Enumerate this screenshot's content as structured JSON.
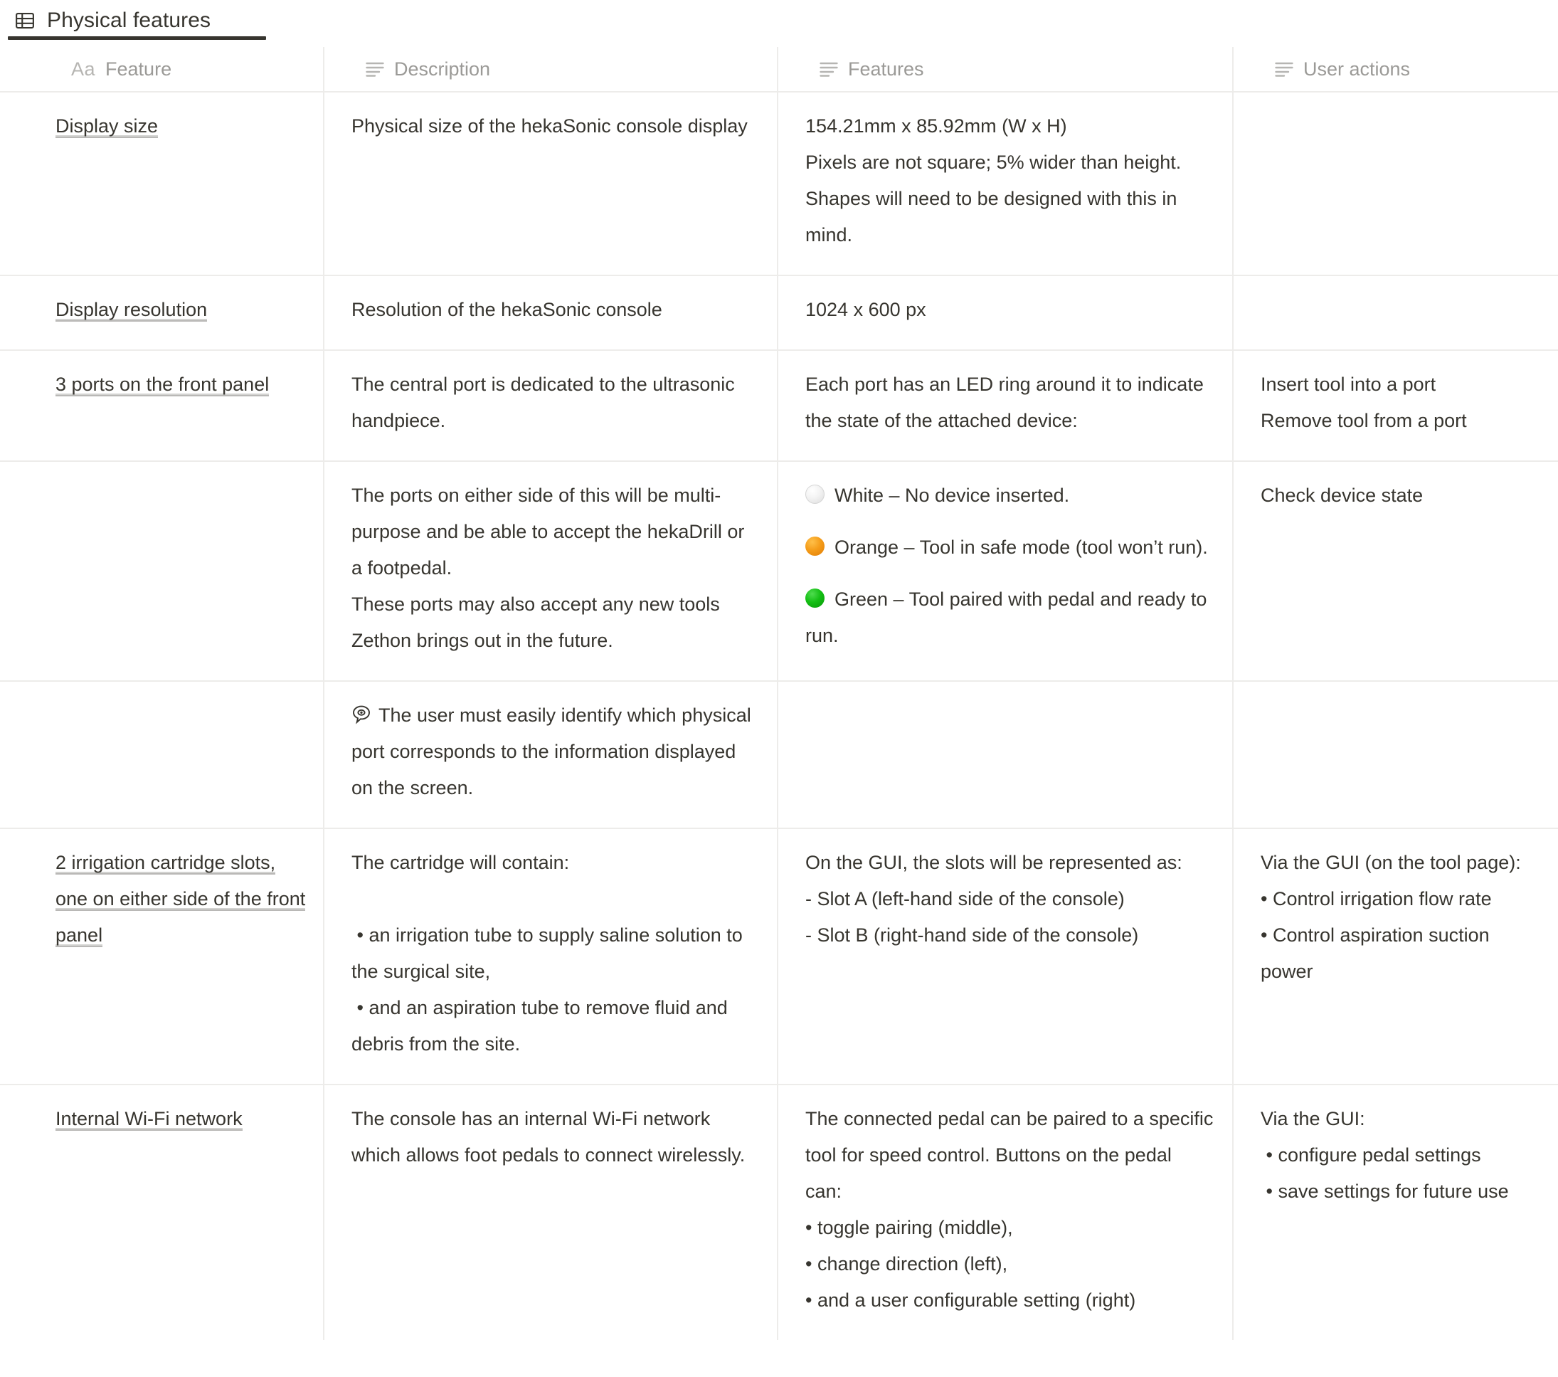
{
  "view": {
    "tab_label": "Physical features",
    "tab_icon": "table-icon",
    "active": true
  },
  "table": {
    "columns": [
      {
        "label": "Feature",
        "icon": "title-text-icon"
      },
      {
        "label": "Description",
        "icon": "text-lines-icon"
      },
      {
        "label": "Features",
        "icon": "text-lines-icon"
      },
      {
        "label": "User actions",
        "icon": "text-lines-icon"
      }
    ],
    "rows": [
      {
        "feature": "Display size",
        "description": "Physical size of the hekaSonic console display",
        "features": "154.21mm x 85.92mm (W x H)\nPixels are not square; 5% wider than height. Shapes will need to be designed with this in mind.",
        "user_actions": ""
      },
      {
        "feature": "Display resolution",
        "description": "Resolution of the hekaSonic console",
        "features": "1024 x 600 px",
        "user_actions": ""
      },
      {
        "feature": "3 ports on the front panel",
        "description": "The central port is dedicated to the ultrasonic handpiece.",
        "features": "Each port has an LED ring around it to indicate the state of the attached device:",
        "user_actions": "Insert tool into a port\nRemove tool from a port"
      },
      {
        "feature": "",
        "description": "The ports on either side of this will be multi-purpose and be able to accept the hekaDrill or a footpedal.\nThese ports may also accept any new tools Zethon brings out in the future.",
        "features_led": [
          {
            "color_name": "white",
            "color": "#f1f1f1",
            "text": "White – No device inserted."
          },
          {
            "color_name": "orange",
            "color": "#f59d1a",
            "text": "Orange – Tool in safe mode (tool won’t run)."
          },
          {
            "color_name": "green",
            "color": "#14bf14",
            "text": "Green – Tool paired with pedal and ready to run."
          }
        ],
        "user_actions": "Check device state"
      },
      {
        "feature": "",
        "description_icon": "eye-in-speech-bubble-icon",
        "description": "The user must easily identify which physical port corresponds to the information displayed on the screen.",
        "features": "",
        "user_actions": ""
      },
      {
        "feature": "2 irrigation cartridge slots, one on either side of the front panel",
        "description": "The cartridge will contain:\n\n • an irrigation tube to supply saline solution to the surgical site,\n • and an aspiration tube to remove fluid and debris from the site.",
        "features": "On the GUI, the slots will be represented as:\n- Slot A (left-hand side of the console)\n- Slot B (right-hand side of the console)",
        "user_actions": "Via the GUI (on the tool page):\n• Control irrigation flow rate\n• Control aspiration suction power"
      },
      {
        "feature": "Internal Wi-Fi network",
        "description": "The console has an internal Wi-Fi network which allows foot pedals to connect wirelessly.",
        "features": "The connected pedal can be paired to a specific tool for speed control. Buttons on the pedal\ncan:\n• toggle pairing (middle),\n• change direction (left),\n• and a user configurable setting (right)",
        "user_actions": "Via the GUI:\n • configure pedal settings\n • save settings for future use"
      }
    ]
  },
  "colors": {
    "text": "#37352f",
    "muted": "#9b9a97",
    "border": "#edecea",
    "accent": "#37352f"
  }
}
